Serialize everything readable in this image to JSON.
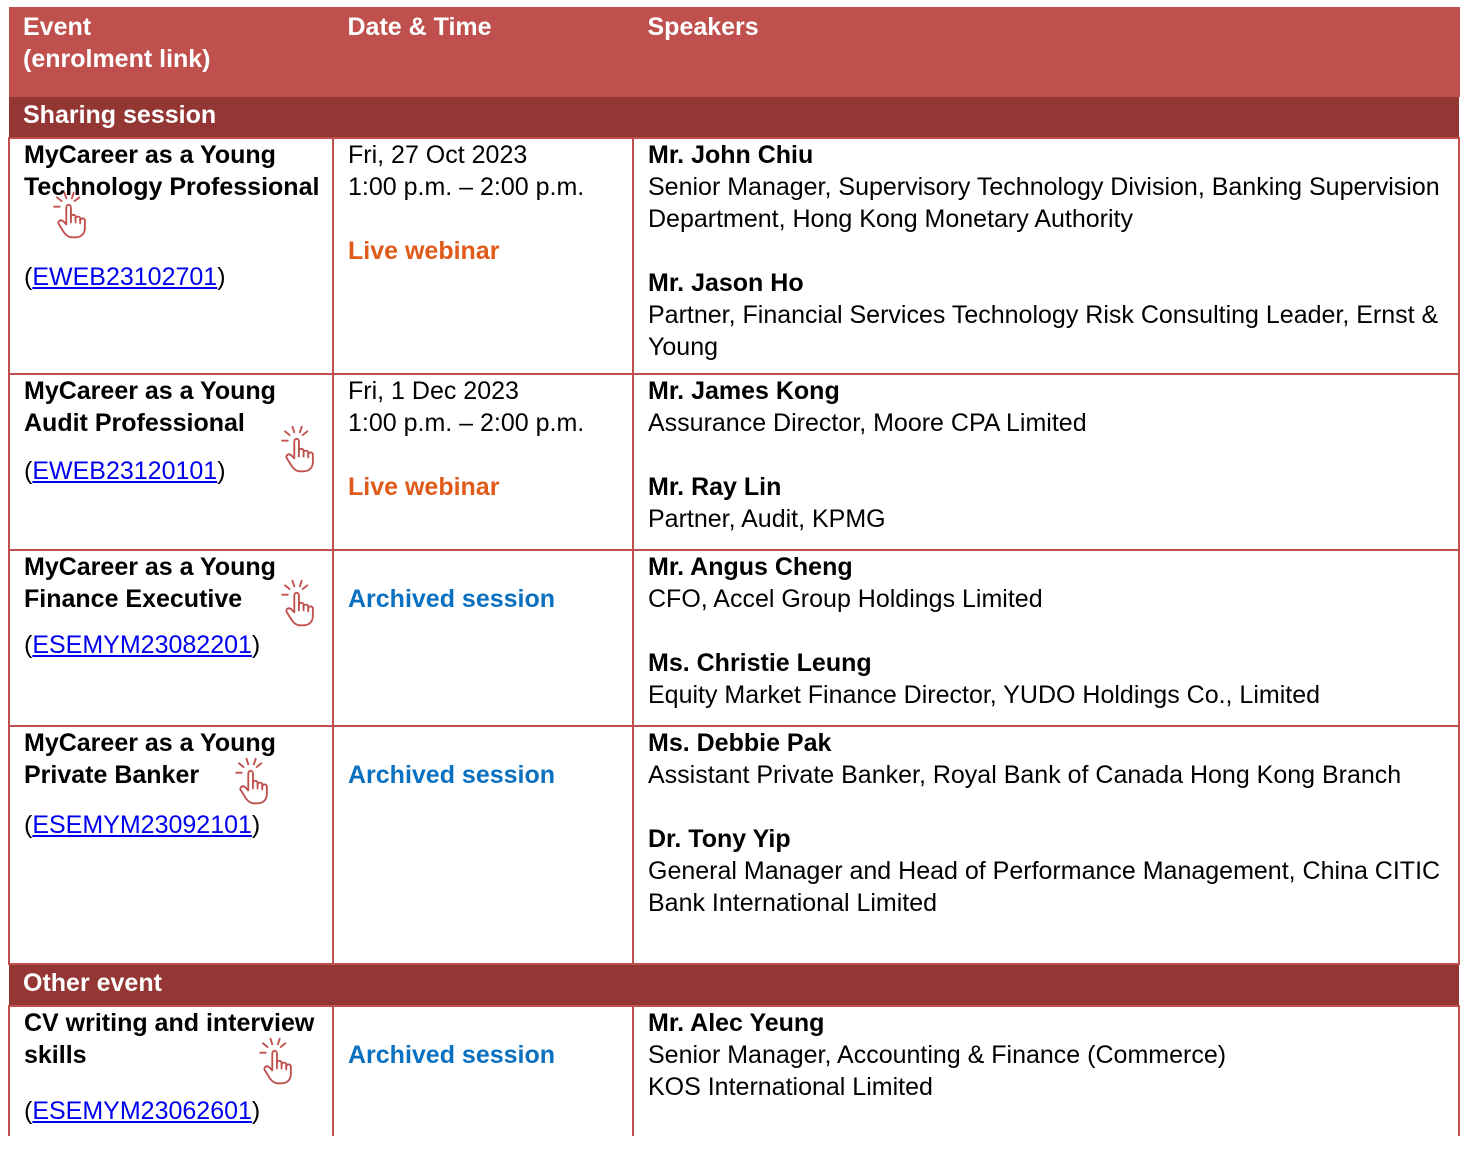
{
  "header": {
    "event_line1": "Event",
    "event_line2": "(enrolment link)",
    "datetime": "Date & Time",
    "speakers": "Speakers"
  },
  "sections": {
    "sharing": "Sharing session",
    "other": "Other event"
  },
  "events": [
    {
      "title": "MyCareer as a Young Technology Professional",
      "code": "EWEB23102701",
      "date": "Fri, 27 Oct 2023",
      "time": "1:00 p.m. – 2:00 p.m.",
      "mode": "Live webinar",
      "speakers": [
        {
          "name": "Mr. John Chiu",
          "role": "Senior Manager, Supervisory Technology Division, Banking Supervision Department, Hong Kong Monetary Authority"
        },
        {
          "name": "Mr. Jason Ho",
          "role": "Partner, Financial Services Technology Risk Consulting Leader, Ernst & Young"
        }
      ]
    },
    {
      "title": "MyCareer as a Young Audit Professional",
      "code": "EWEB23120101",
      "date": "Fri, 1 Dec 2023",
      "time": "1:00 p.m. – 2:00 p.m.",
      "mode": "Live webinar",
      "speakers": [
        {
          "name": "Mr. James Kong",
          "role": "Assurance Director, Moore CPA Limited"
        },
        {
          "name": "Mr. Ray Lin",
          "role": "Partner, Audit, KPMG"
        }
      ]
    },
    {
      "title": "MyCareer as a Young Finance Executive",
      "code": "ESEMYM23082201",
      "mode": "Archived session",
      "speakers": [
        {
          "name": "Mr. Angus Cheng",
          "role": "CFO, Accel Group Holdings Limited"
        },
        {
          "name": "Ms. Christie Leung",
          "role": "Equity Market Finance Director, YUDO Holdings Co., Limited"
        }
      ]
    },
    {
      "title": "MyCareer as a Young Private Banker",
      "code": "ESEMYM23092101",
      "mode": "Archived session",
      "speakers": [
        {
          "name": "Ms. Debbie Pak",
          "role": "Assistant Private Banker, Royal Bank of Canada Hong Kong Branch"
        },
        {
          "name": "Dr. Tony Yip",
          "role": "General Manager and Head of Performance Management, China CITIC Bank International Limited"
        }
      ]
    },
    {
      "title": "CV writing and interview skills",
      "code": "ESEMYM23062601",
      "mode": "Archived session",
      "speakers": [
        {
          "name": "Mr. Alec Yeung",
          "role_line1": "Senior Manager, Accounting & Finance (Commerce)",
          "role_line2": "KOS International Limited"
        }
      ]
    }
  ],
  "icons": {
    "pointer": "hand-pointer-click-icon"
  },
  "colors": {
    "header": "#c0504d",
    "section": "#943634",
    "live": "#e05a1a",
    "archived": "#0a70c0",
    "link": "#0000ee"
  }
}
